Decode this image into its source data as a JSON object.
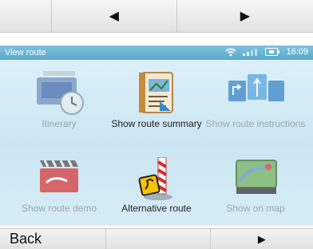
{
  "top_nav": {
    "prev_glyph": "◀",
    "next_glyph": "▶"
  },
  "status_bar": {
    "title": "View route",
    "time": "16:09",
    "icons": [
      "wifi-icon",
      "signal-icon",
      "battery-icon"
    ]
  },
  "menu": {
    "tiles": [
      {
        "id": "itinerary",
        "label": "Itinerary",
        "icon": "itinerary-icon",
        "enabled": false
      },
      {
        "id": "summary",
        "label": "Show route summary",
        "icon": "route-summary-icon",
        "enabled": true
      },
      {
        "id": "instructions",
        "label": "Show route instructions",
        "icon": "route-instructions-icon",
        "enabled": false
      },
      {
        "id": "demo",
        "label": "Show route demo",
        "icon": "route-demo-icon",
        "enabled": false
      },
      {
        "id": "alternative",
        "label": "Alternative route",
        "icon": "alternative-route-icon",
        "enabled": true
      },
      {
        "id": "map",
        "label": "Show on map",
        "icon": "map-icon",
        "enabled": false
      }
    ]
  },
  "bottom_bar": {
    "back_label": "Back",
    "next_glyph": "▶"
  },
  "colors": {
    "status_bar": "#5aa9c9",
    "screen_bg": "#d6eef8",
    "disabled_text": "#9aa7ad"
  }
}
